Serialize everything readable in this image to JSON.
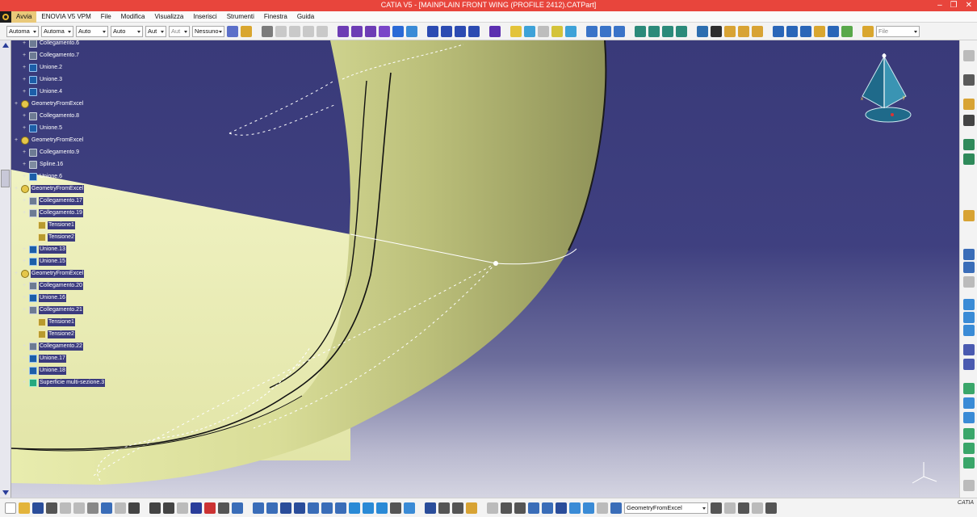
{
  "window": {
    "title": "CATIA V5 - [MAINPLAIN FRONT WING (PROFILE 2412).CATPart]",
    "minimize": "‒",
    "restore": "❐",
    "close": "✕"
  },
  "menu": [
    "Avvia",
    "ENOVIA V5 VPM",
    "File",
    "Modifica",
    "Visualizza",
    "Inserisci",
    "Strumenti",
    "Finestra",
    "Guida"
  ],
  "toolbar": {
    "combos": [
      "Automa",
      "Automa",
      "Auto",
      "Auto",
      "Aut",
      "Aut",
      "Nessuno"
    ],
    "file_combo": "File"
  },
  "tree": [
    {
      "label": "Collegamento.6",
      "icon": "link-icon",
      "indent": 2,
      "hl": false
    },
    {
      "label": "Collegamento.7",
      "icon": "link-icon",
      "indent": 2,
      "hl": false
    },
    {
      "label": "Unione.2",
      "icon": "union-icon",
      "indent": 2,
      "hl": false
    },
    {
      "label": "Unione.3",
      "icon": "union-icon",
      "indent": 2,
      "hl": false
    },
    {
      "label": "Unione.4",
      "icon": "union-icon",
      "indent": 2,
      "hl": false
    },
    {
      "label": "GeometryFromExcel",
      "icon": "geometry-set-icon",
      "indent": 1,
      "hl": false
    },
    {
      "label": "Collegamento.8",
      "icon": "link-icon",
      "indent": 2,
      "hl": false
    },
    {
      "label": "Unione.5",
      "icon": "union-icon",
      "indent": 2,
      "hl": false
    },
    {
      "label": "GeometryFromExcel",
      "icon": "geometry-set-icon",
      "indent": 1,
      "hl": false
    },
    {
      "label": "Collegamento.9",
      "icon": "link-icon",
      "indent": 2,
      "hl": false
    },
    {
      "label": "Spline.16",
      "icon": "spline-icon",
      "indent": 2,
      "hl": false
    },
    {
      "label": "Unione.6",
      "icon": "union-icon",
      "indent": 2,
      "hl": false
    },
    {
      "label": "GeometryFromExcel",
      "icon": "geometry-set-icon",
      "indent": 1,
      "hl": true
    },
    {
      "label": "Collegamento.17",
      "icon": "link-icon",
      "indent": 2,
      "hl": true
    },
    {
      "label": "Collegamento.19",
      "icon": "link-icon",
      "indent": 2,
      "hl": true
    },
    {
      "label": "Tensione1",
      "icon": "tension-icon",
      "indent": 3,
      "hl": true
    },
    {
      "label": "Tensione2",
      "icon": "tension-icon",
      "indent": 3,
      "hl": true
    },
    {
      "label": "Unione.13",
      "icon": "union-icon",
      "indent": 2,
      "hl": true
    },
    {
      "label": "Unione.15",
      "icon": "union-icon",
      "indent": 2,
      "hl": true
    },
    {
      "label": "GeometryFromExcel",
      "icon": "geometry-set-icon",
      "indent": 1,
      "hl": true
    },
    {
      "label": "Collegamento.20",
      "icon": "link-icon",
      "indent": 2,
      "hl": true
    },
    {
      "label": "Unione.16",
      "icon": "union-icon",
      "indent": 2,
      "hl": true
    },
    {
      "label": "Collegamento.21",
      "icon": "link-icon",
      "indent": 2,
      "hl": true
    },
    {
      "label": "Tensione1",
      "icon": "tension-icon",
      "indent": 3,
      "hl": true
    },
    {
      "label": "Tensione2",
      "icon": "tension-icon",
      "indent": 3,
      "hl": true
    },
    {
      "label": "Collegamento.22",
      "icon": "link-icon",
      "indent": 2,
      "hl": true
    },
    {
      "label": "Unione.17",
      "icon": "union-icon",
      "indent": 2,
      "hl": true
    },
    {
      "label": "Unione.18",
      "icon": "union-icon",
      "indent": 2,
      "hl": true
    },
    {
      "label": "Superficie multi-sezione.3",
      "icon": "multi-section-surface-icon",
      "indent": 2,
      "hl": true
    }
  ],
  "bottom": {
    "geometry_combo": "GeometryFromExcel",
    "logo": "CATIA"
  },
  "colors": {
    "titlebar": "#e8453c",
    "surface": "#e6e9a8",
    "background": "#3f4080",
    "highlight": "#3b3b7e"
  }
}
